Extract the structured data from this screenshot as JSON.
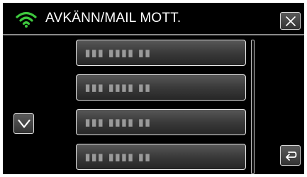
{
  "header": {
    "title": "AVKÄNN/MAIL MOTT.",
    "status_icon": "wifi-icon",
    "close_icon": "close-icon",
    "accent_color": "#3ec83e"
  },
  "list": {
    "items": [
      {
        "label": "▮▮▮ ▮▮▮▮ ▮▮"
      },
      {
        "label": "▮▮▮ ▮▮▮▮ ▮▮"
      },
      {
        "label": "▮▮▮ ▮▮▮▮ ▮▮"
      },
      {
        "label": "▮▮▮ ▮▮▮▮ ▮▮"
      }
    ]
  },
  "controls": {
    "scroll_down_icon": "chevron-down-icon",
    "back_icon": "return-arrow-icon"
  }
}
